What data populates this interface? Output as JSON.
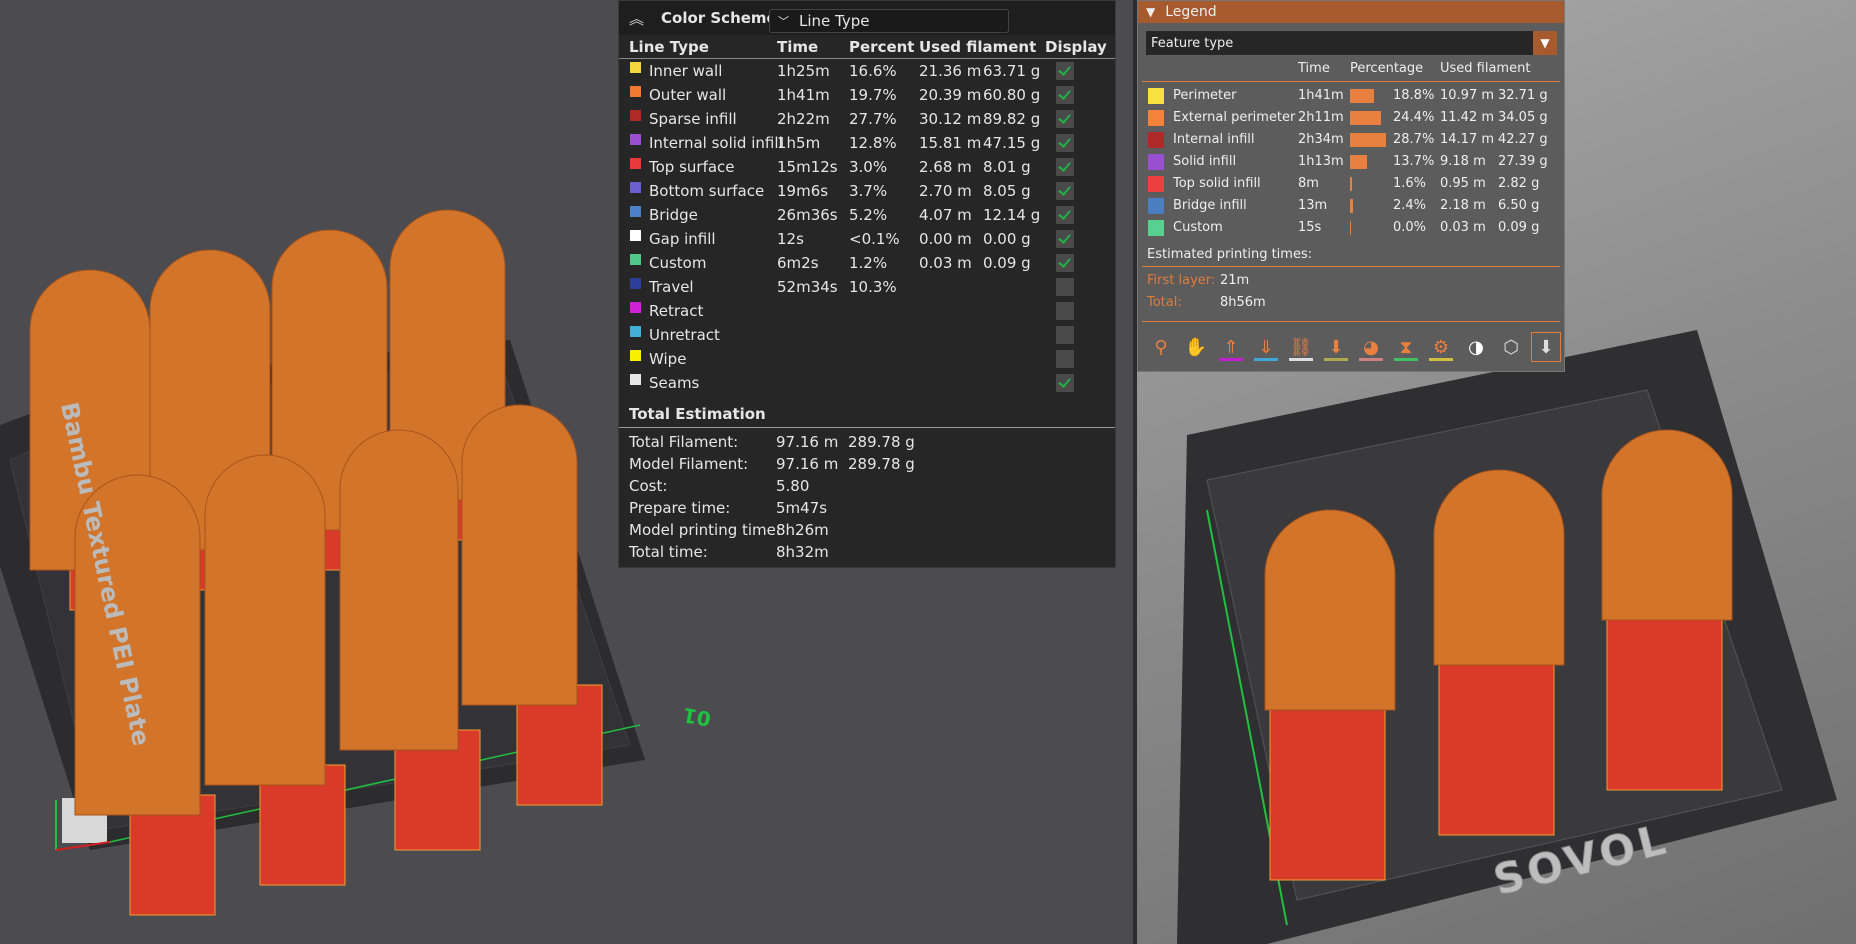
{
  "left_viewport": {
    "plate_label": "Bambu Textured PEI Plate",
    "axis_label": "01"
  },
  "color_scheme": {
    "title": "Color Scheme",
    "selected": "Line Type",
    "columns": [
      "Line Type",
      "Time",
      "Percent",
      "Used filament",
      "Display"
    ],
    "rows": [
      {
        "name": "Inner wall",
        "color": "#f5d63f",
        "time": "1h25m",
        "percent": "16.6%",
        "length": "21.36 m",
        "weight": "63.71 g",
        "display": true
      },
      {
        "name": "Outer wall",
        "color": "#f07a30",
        "time": "1h41m",
        "percent": "19.7%",
        "length": "20.39 m",
        "weight": "60.80 g",
        "display": true
      },
      {
        "name": "Sparse infill",
        "color": "#b02a25",
        "time": "2h22m",
        "percent": "27.7%",
        "length": "30.12 m",
        "weight": "89.82 g",
        "display": true
      },
      {
        "name": "Internal solid infill",
        "color": "#9b4fd0",
        "time": "1h5m",
        "percent": "12.8%",
        "length": "15.81 m",
        "weight": "47.15 g",
        "display": true
      },
      {
        "name": "Top surface",
        "color": "#e83a3a",
        "time": "15m12s",
        "percent": "3.0%",
        "length": "2.68 m",
        "weight": "8.01 g",
        "display": true
      },
      {
        "name": "Bottom surface",
        "color": "#6a5ed0",
        "time": "19m6s",
        "percent": "3.7%",
        "length": "2.70 m",
        "weight": "8.05 g",
        "display": true
      },
      {
        "name": "Bridge",
        "color": "#4a80c8",
        "time": "26m36s",
        "percent": "5.2%",
        "length": "4.07 m",
        "weight": "12.14 g",
        "display": true
      },
      {
        "name": "Gap infill",
        "color": "#ffffff",
        "time": "12s",
        "percent": "<0.1%",
        "length": "0.00 m",
        "weight": "0.00 g",
        "display": true
      },
      {
        "name": "Custom",
        "color": "#50c88a",
        "time": "6m2s",
        "percent": "1.2%",
        "length": "0.03 m",
        "weight": "0.09 g",
        "display": true
      },
      {
        "name": "Travel",
        "color": "#2e3f9a",
        "time": "52m34s",
        "percent": "10.3%",
        "length": "",
        "weight": "",
        "display": false
      },
      {
        "name": "Retract",
        "color": "#d020d8",
        "time": "",
        "percent": "",
        "length": "",
        "weight": "",
        "display": false
      },
      {
        "name": "Unretract",
        "color": "#40b0d8",
        "time": "",
        "percent": "",
        "length": "",
        "weight": "",
        "display": false
      },
      {
        "name": "Wipe",
        "color": "#f8f000",
        "time": "",
        "percent": "",
        "length": "",
        "weight": "",
        "display": false
      },
      {
        "name": "Seams",
        "color": "#e6e6e6",
        "time": "",
        "percent": "",
        "length": "",
        "weight": "",
        "display": true
      }
    ],
    "total_title": "Total Estimation",
    "totals": [
      {
        "label": "Total Filament:",
        "v1": "97.16 m",
        "v2": "289.78 g"
      },
      {
        "label": "Model Filament:",
        "v1": "97.16 m",
        "v2": "289.78 g"
      },
      {
        "label": "Cost:",
        "v1": "5.80",
        "v2": ""
      },
      {
        "label": "Prepare time:",
        "v1": "5m47s",
        "v2": ""
      },
      {
        "label": "Model printing time:",
        "v1": "8h26m",
        "v2": ""
      },
      {
        "label": "Total time:",
        "v1": "8h32m",
        "v2": ""
      }
    ]
  },
  "legend": {
    "title": "Legend",
    "selected": "Feature type",
    "columns": [
      "Time",
      "Percentage",
      "Used filament"
    ],
    "rows": [
      {
        "name": "Perimeter",
        "color": "#f8e040",
        "time": "1h41m",
        "pct": 18.8,
        "pct_label": "18.8%",
        "length": "10.97 m",
        "weight": "32.71 g"
      },
      {
        "name": "External perimeter",
        "color": "#f5843a",
        "time": "2h11m",
        "pct": 24.4,
        "pct_label": "24.4%",
        "length": "11.42 m",
        "weight": "34.05 g"
      },
      {
        "name": "Internal infill",
        "color": "#b02a2a",
        "time": "2h34m",
        "pct": 28.7,
        "pct_label": "28.7%",
        "length": "14.17 m",
        "weight": "42.27 g"
      },
      {
        "name": "Solid infill",
        "color": "#9850d0",
        "time": "1h13m",
        "pct": 13.7,
        "pct_label": "13.7%",
        "length": "9.18 m",
        "weight": "27.39 g"
      },
      {
        "name": "Top solid infill",
        "color": "#ec4040",
        "time": "8m",
        "pct": 1.6,
        "pct_label": "1.6%",
        "length": "0.95 m",
        "weight": "2.82 g"
      },
      {
        "name": "Bridge infill",
        "color": "#4a7ec0",
        "time": "13m",
        "pct": 2.4,
        "pct_label": "2.4%",
        "length": "2.18 m",
        "weight": "6.50 g"
      },
      {
        "name": "Custom",
        "color": "#58d090",
        "time": "15s",
        "pct": 0.0,
        "pct_label": "0.0%",
        "length": "0.03 m",
        "weight": "0.09 g"
      }
    ],
    "estimated_title": "Estimated printing times:",
    "first_layer_label": "First layer:",
    "first_layer": "21m",
    "total_label": "Total:",
    "total": "8h56m",
    "toolbar_icons": [
      {
        "name": "travel-icon",
        "underline": ""
      },
      {
        "name": "seam-icon",
        "underline": ""
      },
      {
        "name": "retract-icon",
        "underline": "#c020d0"
      },
      {
        "name": "deretract-icon",
        "underline": "#40a8d8"
      },
      {
        "name": "wipe-icon",
        "underline": "#dddddd"
      },
      {
        "name": "tool-change-icon",
        "underline": "#b0a850"
      },
      {
        "name": "color-change-icon",
        "underline": "#d08080"
      },
      {
        "name": "pause-icon",
        "underline": "#40c060"
      },
      {
        "name": "custom-gcode-icon",
        "underline": "#d0c040"
      },
      {
        "name": "center-of-gravity-icon",
        "underline": ""
      },
      {
        "name": "bounding-box-icon",
        "underline": ""
      },
      {
        "name": "tool-marker-icon",
        "underline": "",
        "selected": true
      }
    ]
  },
  "right_viewport": {
    "bed_logo": "SOVOL"
  }
}
